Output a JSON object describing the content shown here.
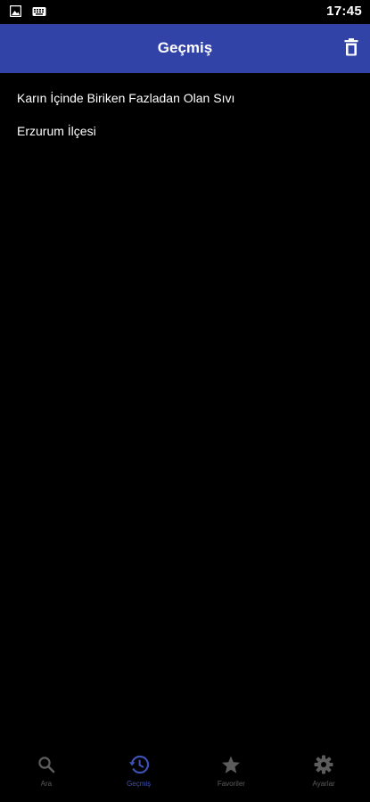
{
  "status_bar": {
    "time": "17:45",
    "left_icons": [
      "image-icon",
      "keyboard-icon"
    ]
  },
  "app_bar": {
    "title": "Geçmiş",
    "action_icon": "trash-icon"
  },
  "history": {
    "items": [
      {
        "label": "Karın İçinde Biriken Fazladan Olan Sıvı"
      },
      {
        "label": "Erzurum İlçesi"
      }
    ]
  },
  "bottom_nav": {
    "items": [
      {
        "label": "Ara",
        "icon": "search-icon",
        "active": false
      },
      {
        "label": "Geçmiş",
        "icon": "history-icon",
        "active": true
      },
      {
        "label": "Favoriler",
        "icon": "star-icon",
        "active": false
      },
      {
        "label": "Ayarlar",
        "icon": "gear-icon",
        "active": false
      }
    ]
  },
  "colors": {
    "app_bar": "#3243a8",
    "active_nav": "#3f51b5",
    "inactive_nav": "#5c5c5c",
    "background": "#000000",
    "text": "#ffffff"
  }
}
